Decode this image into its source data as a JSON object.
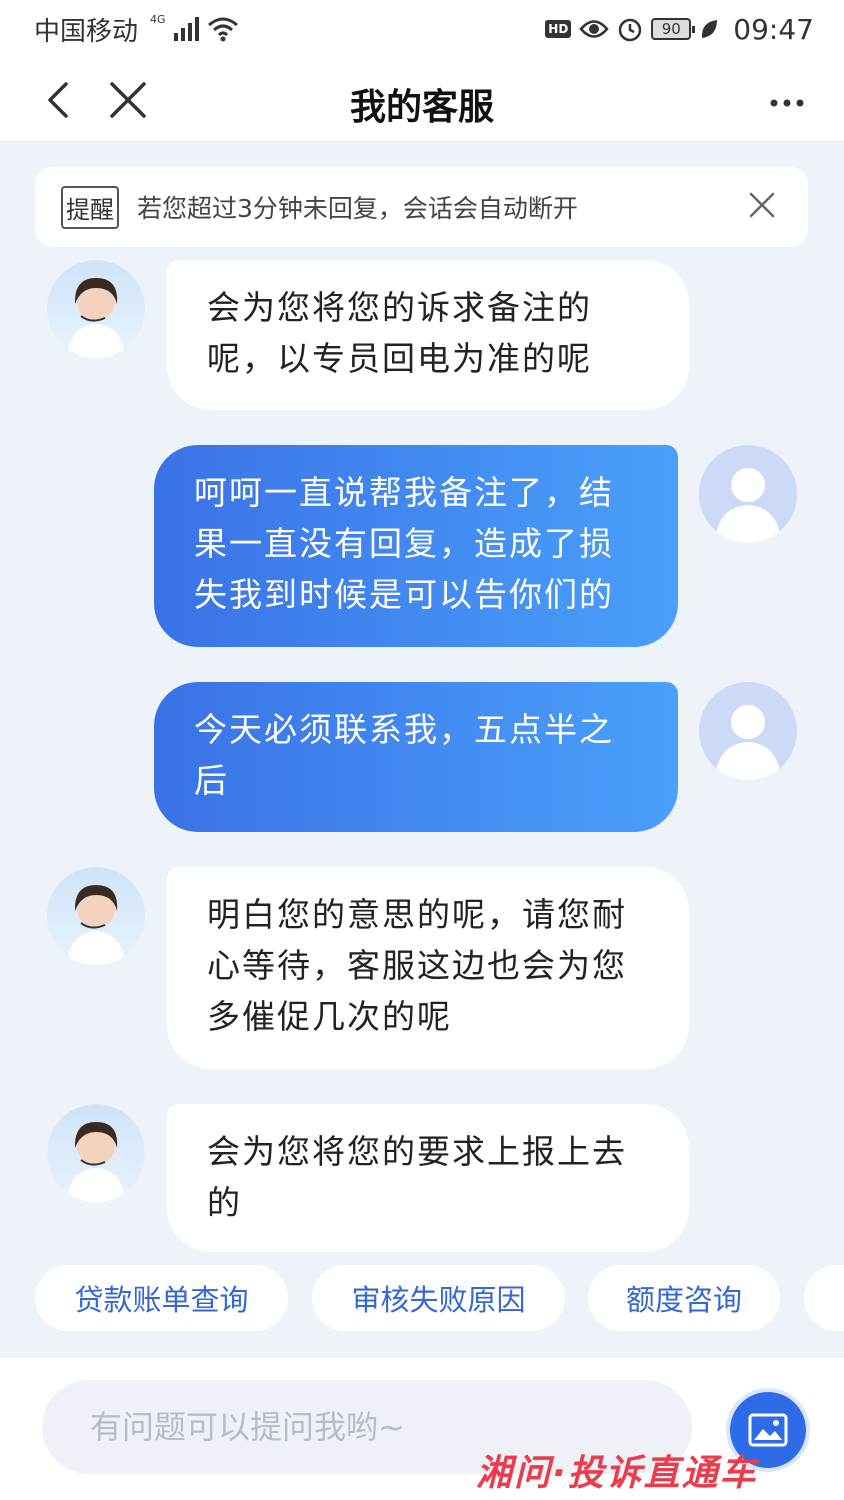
{
  "status_bar": {
    "carrier": "中国移动",
    "network": "4G",
    "hd": "HD",
    "battery": "90",
    "time": "09:47"
  },
  "nav": {
    "title": "我的客服",
    "back_icon": "chevron-left-icon",
    "close_icon": "close-icon",
    "more_icon": "more-dots-icon"
  },
  "notice": {
    "tag": "提醒",
    "text": "若您超过3分钟未回复，会话会自动断开"
  },
  "messages": [
    {
      "sender": "agent",
      "lines": [
        "会为您将您的诉求备注的",
        "呢，以专员回电为准的呢"
      ]
    },
    {
      "sender": "user",
      "lines": [
        "呵呵一直说帮我备注了，结",
        "果一直没有回复，造成了损",
        "失我到时候是可以告你们的"
      ]
    },
    {
      "sender": "user",
      "lines": [
        "今天必须联系我，五点半之",
        "后"
      ]
    },
    {
      "sender": "agent",
      "lines": [
        "明白您的意思的呢，请您耐",
        "心等待，客服这边也会为您",
        "多催促几次的呢"
      ]
    },
    {
      "sender": "agent",
      "lines": [
        "会为您将您的要求上报上去",
        "的"
      ]
    }
  ],
  "quick_replies": [
    "贷款账单查询",
    "审核失败原因",
    "额度咨询"
  ],
  "input": {
    "placeholder": "有问题可以提问我哟~",
    "value": ""
  },
  "watermark": "湘问·投诉直通车",
  "colors": {
    "accent": "#3a72e6",
    "bubble_user_end": "#4aa0fb",
    "background": "#eef3fa",
    "chip_text": "#3566d8",
    "watermark": "#ec3c4b"
  }
}
